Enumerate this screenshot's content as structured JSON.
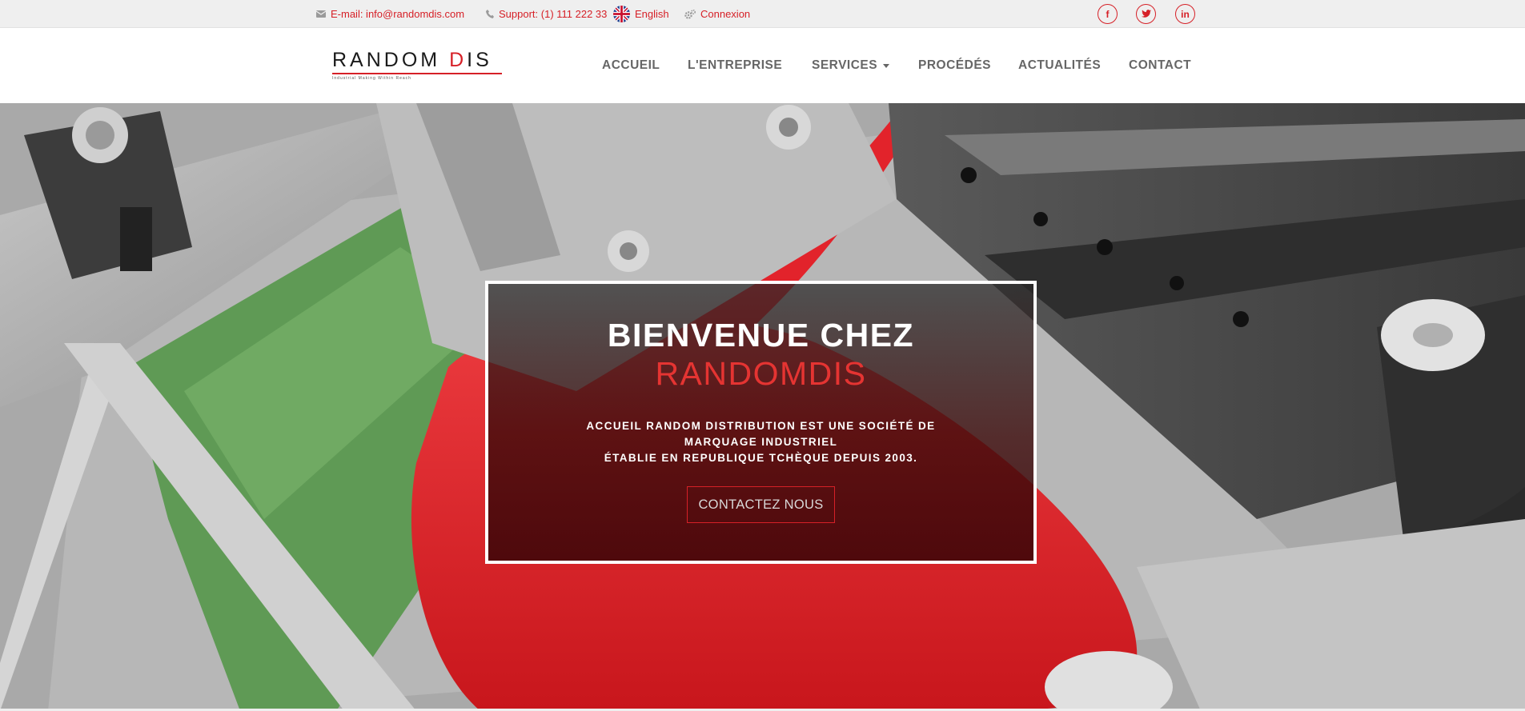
{
  "topbar": {
    "email": "E-mail: info@randomdis.com",
    "support": "Support: (1) 111 222 33",
    "language": "English",
    "login": "Connexion",
    "social": [
      "facebook-icon",
      "twitter-icon",
      "linkedin-icon"
    ]
  },
  "brand": {
    "name_part1": "RANDOM ",
    "name_part2": "D",
    "name_part3": "IS",
    "tagline": "Industrial Making Within Reach"
  },
  "nav": {
    "items": [
      "ACCUEIL",
      "L'ENTREPRISE",
      "SERVICES",
      "PROCÉDÉS",
      "ACTUALITÉS",
      "CONTACT"
    ]
  },
  "hero": {
    "title_line1": "BIENVENUE CHEZ",
    "title_line2": "RANDOMDIS",
    "desc_line1": "ACCUEIL RANDOM DISTRIBUTION EST UNE SOCIÉTÉ DE",
    "desc_line2": "MARQUAGE INDUSTRIEL",
    "desc_line3": "ÉTABLIE EN REPUBLIQUE TCHÈQUE DEPUIS 2003.",
    "cta": "CONTACTEZ NOUS"
  },
  "colors": {
    "accent": "#d62027",
    "topbar_bg": "#efefef",
    "nav_text": "#666666",
    "hero_title_red": "#e53432"
  }
}
